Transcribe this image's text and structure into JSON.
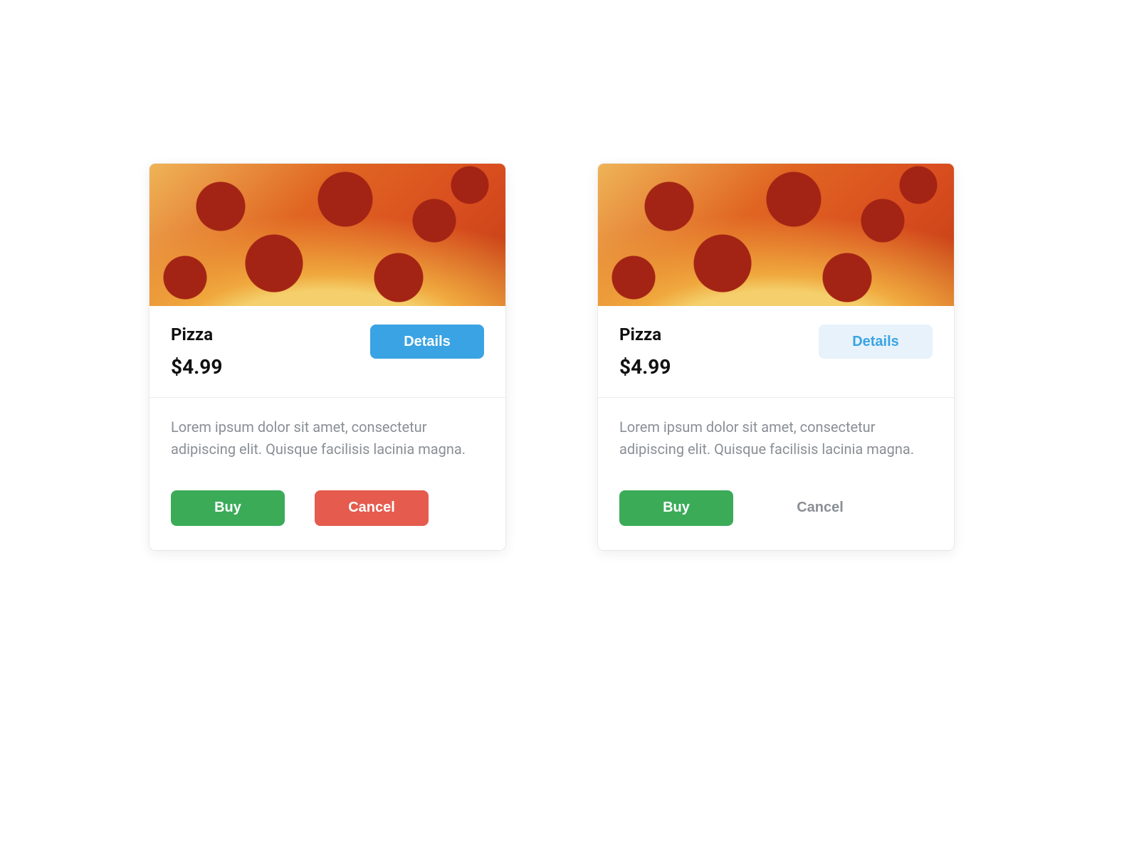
{
  "cards": [
    {
      "image_name": "pizza-image",
      "title": "Pizza",
      "price": "$4.99",
      "details_label": "Details",
      "details_variant": "primary-blue",
      "description": "Lorem ipsum dolor sit amet, consectetur adipiscing elit. Quisque facilisis lacinia magna.",
      "buy_label": "Buy",
      "cancel_label": "Cancel",
      "cancel_variant": "red"
    },
    {
      "image_name": "pizza-image",
      "title": "Pizza",
      "price": "$4.99",
      "details_label": "Details",
      "details_variant": "light-blue",
      "description": "Lorem ipsum dolor sit amet, consectetur adipiscing elit. Quisque facilisis lacinia magna.",
      "buy_label": "Buy",
      "cancel_label": "Cancel",
      "cancel_variant": "ghost"
    }
  ],
  "colors": {
    "primary_blue": "#3aa3e3",
    "light_blue_bg": "#e7f2fb",
    "green": "#3bab58",
    "red": "#e55b4e",
    "text_muted": "#8a8f95"
  }
}
